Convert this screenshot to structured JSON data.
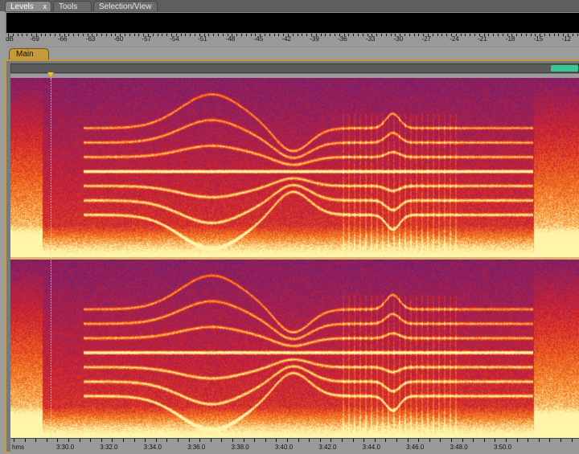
{
  "tabs": {
    "levels": "Levels",
    "levels_close": "x",
    "tools": "Tools",
    "selection_view": "Selection/View"
  },
  "levels": {
    "unit": "dB",
    "scale": [
      "-69",
      "-66",
      "-63",
      "-60",
      "-57",
      "-54",
      "-51",
      "-48",
      "-45",
      "-42",
      "-39",
      "-36",
      "-33",
      "-30",
      "-27",
      "-24",
      "-21",
      "-18",
      "-15",
      "-12",
      "-9"
    ]
  },
  "main": {
    "tab_label": "Main"
  },
  "timeline": {
    "unit": "hms",
    "labels": [
      "3:30.0",
      "3:32.0",
      "3:34.0",
      "3:36.0",
      "3:38.0",
      "3:40.0",
      "3:42.0",
      "3:44.0",
      "3:46.0",
      "3:48.0",
      "3:50.0"
    ]
  },
  "colors": {
    "panel_accent": "#c49a3a",
    "overview_thumb": "#36c69a",
    "playhead": "#f2c400",
    "spectrogram_low": "#3a1d66",
    "spectrogram_mid": "#d0202a",
    "spectrogram_high": "#fff2a0"
  }
}
